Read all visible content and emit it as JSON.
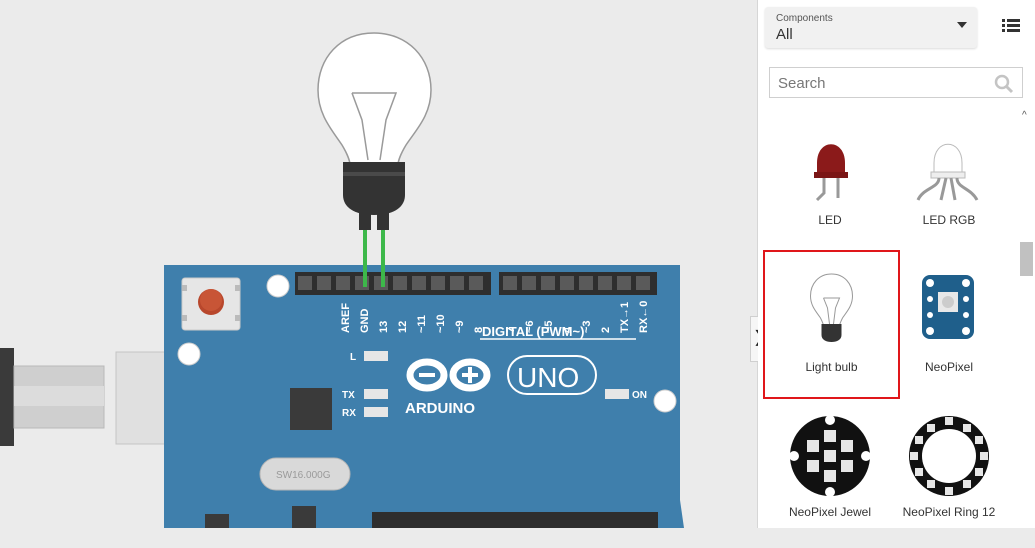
{
  "board": {
    "pin_labels_left": [
      "AREF",
      "GND",
      "13",
      "12",
      "~11",
      "~10",
      "~9",
      "8"
    ],
    "pin_labels_right": [
      "7",
      "~6",
      "~5",
      "4",
      "~3",
      "2",
      "TX→1",
      "RX←0"
    ],
    "digital_label": "DIGITAL (PWM~)",
    "led_l": "L",
    "led_tx": "TX",
    "led_rx": "RX",
    "brand": "ARDUINO",
    "model": "UNO",
    "on_label": "ON",
    "crystal_label": "SW16.000G"
  },
  "sidebar": {
    "components_label": "Components",
    "components_value": "All",
    "search_placeholder": "Search",
    "items": [
      {
        "label": "LED"
      },
      {
        "label": "LED RGB"
      },
      {
        "label": "Light bulb"
      },
      {
        "label": "NeoPixel"
      },
      {
        "label": "NeoPixel Jewel"
      },
      {
        "label": "NeoPixel Ring 12"
      }
    ]
  },
  "colors": {
    "board_blue": "#3f7fac",
    "selection_red": "#e0161a",
    "wire_green": "#3db84a",
    "led_red": "#8b1a1a"
  }
}
